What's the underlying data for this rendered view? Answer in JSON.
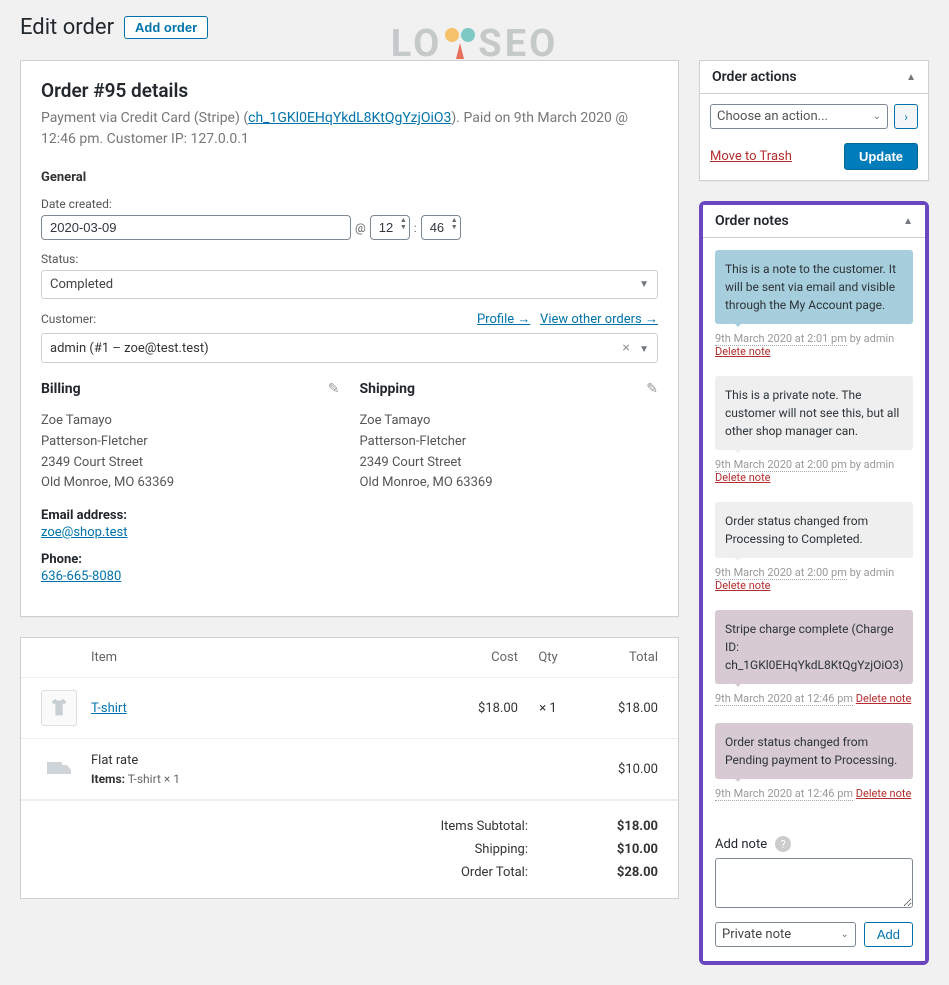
{
  "header": {
    "title": "Edit order",
    "add_order": "Add order",
    "watermark": "LO SEO"
  },
  "order": {
    "title": "Order #95 details",
    "payment_pre": "Payment via Credit Card (Stripe) (",
    "payment_link": "ch_1GKl0EHqYkdL8KtQgYzjOiO3",
    "payment_post": "). Paid on 9th March 2020 @ 12:46 pm. Customer IP: 127.0.0.1",
    "general_label": "General",
    "date_label": "Date created:",
    "date_value": "2020-03-09",
    "hour": "12",
    "minute": "46",
    "status_label": "Status:",
    "status_value": "Completed",
    "customer_label": "Customer:",
    "profile_link": "Profile →",
    "view_orders_link": "View other orders →",
    "customer_value": "admin (#1 – zoe@test.test)"
  },
  "billing": {
    "heading": "Billing",
    "name": "Zoe Tamayo",
    "company": "Patterson-Fletcher",
    "street": "2349 Court Street",
    "city": "Old Monroe, MO 63369",
    "email_label": "Email address:",
    "email": "zoe@shop.test",
    "phone_label": "Phone:",
    "phone": "636-665-8080"
  },
  "shipping": {
    "heading": "Shipping",
    "name": "Zoe Tamayo",
    "company": "Patterson-Fletcher",
    "street": "2349 Court Street",
    "city": "Old Monroe, MO 63369"
  },
  "items": {
    "head_item": "Item",
    "head_cost": "Cost",
    "head_qty": "Qty",
    "head_total": "Total",
    "product_name": "T-shirt",
    "product_cost": "$18.00",
    "product_qty": "× 1",
    "product_total": "$18.00",
    "shipping_name": "Flat rate",
    "shipping_total": "$10.00",
    "shipping_meta_label": "Items:",
    "shipping_meta_val": "T-shirt × 1",
    "subtotal_label": "Items Subtotal:",
    "subtotal": "$18.00",
    "ship_label": "Shipping:",
    "ship": "$10.00",
    "total_label": "Order Total:",
    "total": "$28.00"
  },
  "actions": {
    "heading": "Order actions",
    "placeholder": "Choose an action...",
    "trash": "Move to Trash",
    "update": "Update"
  },
  "notes": {
    "heading": "Order notes",
    "list": [
      {
        "cls": "customer",
        "text": "This is a note to the customer. It will be sent via email and visible through the My Account page.",
        "ts": "9th March 2020 at 2:01 pm",
        "by": " by admin ",
        "del": "Delete note"
      },
      {
        "cls": "private",
        "text": "This is a private note. The customer will not see this, but all other shop manager can.",
        "ts": "9th March 2020 at 2:00 pm",
        "by": " by admin ",
        "del": "Delete note"
      },
      {
        "cls": "private",
        "text": "Order status changed from Processing to Completed.",
        "ts": "9th March 2020 at 2:00 pm",
        "by": " by admin ",
        "del": "Delete note"
      },
      {
        "cls": "system",
        "text": "Stripe charge complete (Charge ID: ch_1GKl0EHqYkdL8KtQgYzjOiO3)",
        "ts": "9th March 2020 at 12:46 pm",
        "by": " ",
        "del": "Delete note"
      },
      {
        "cls": "system",
        "text": "Order status changed from Pending payment to Processing.",
        "ts": "9th March 2020 at 12:46 pm",
        "by": " ",
        "del": "Delete note"
      }
    ],
    "add_label": "Add note",
    "type": "Private note",
    "add_btn": "Add"
  }
}
